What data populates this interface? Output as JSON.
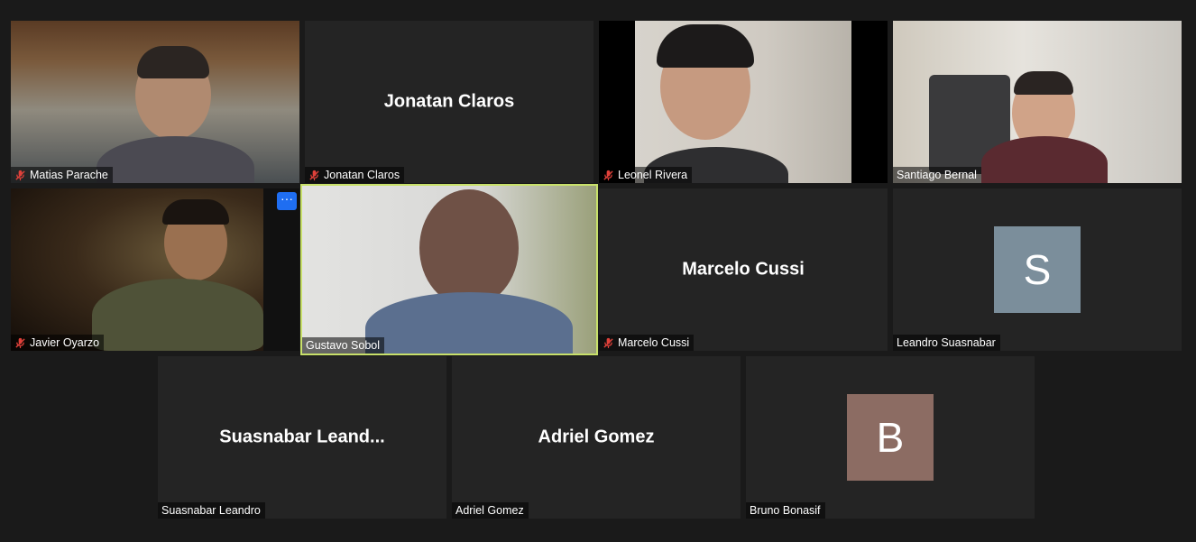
{
  "participants": [
    {
      "name": "Matias Parache",
      "muted": true,
      "view": "video"
    },
    {
      "name": "Jonatan Claros",
      "muted": true,
      "view": "name",
      "display": "Jonatan Claros"
    },
    {
      "name": "Leonel Rivera",
      "muted": true,
      "view": "video"
    },
    {
      "name": "Santiago Bernal",
      "muted": false,
      "view": "video"
    },
    {
      "name": "Javier Oyarzo",
      "muted": true,
      "view": "video",
      "more_label": "···"
    },
    {
      "name": "Gustavo Sobol",
      "muted": false,
      "view": "video",
      "speaking": true
    },
    {
      "name": "Marcelo Cussi",
      "muted": true,
      "view": "name",
      "display": "Marcelo Cussi"
    },
    {
      "name": "Leandro Suasnabar",
      "muted": false,
      "view": "avatar",
      "initial": "S",
      "avatar_color": "#7b8e9b"
    },
    {
      "name": "Suasnabar Leandro",
      "muted": false,
      "view": "name",
      "display": "Suasnabar  Leand..."
    },
    {
      "name": "Adriel Gomez",
      "muted": false,
      "view": "name",
      "display": "Adriel Gomez"
    },
    {
      "name": "Bruno Bonasif",
      "muted": false,
      "view": "avatar",
      "initial": "B",
      "avatar_color": "#8c6c63"
    }
  ],
  "colors": {
    "background": "#1a1a1a",
    "tile": "#242424",
    "speaker_highlight": "#c8e06a",
    "mute": "#e0413a",
    "more_button": "#1f6ef2"
  },
  "icons": {
    "mute": "mic-off-icon",
    "more": "more-options-icon"
  }
}
